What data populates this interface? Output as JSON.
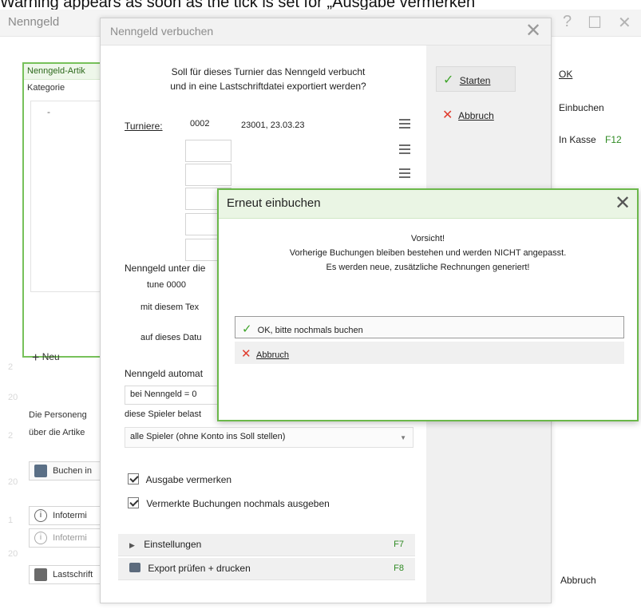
{
  "caption": "Warning appears as soon as the tick is set for „Ausgabe vermerken\"",
  "background": {
    "title": "Nenngeld",
    "panel_header": "Nenngeld-Artik",
    "kategorie_label": "Kategorie",
    "list_item": "-",
    "neu_label": "Neu",
    "personen_line1": "Die Personeng",
    "personen_line2": "über die Artike",
    "buchen_btn": "Buchen in",
    "info_btn1": "Infotermi",
    "info_btn2": "Infotermi",
    "lastschrift_btn": "Lastschrift",
    "right_ok": "OK",
    "right_einbuchen": "Einbuchen",
    "right_kasse": "In Kasse",
    "right_kasse_key": "F12",
    "right_abbruch": "Abbruch"
  },
  "dialog": {
    "title": "Nenngeld verbuchen",
    "question_line1": "Soll für dieses Turnier das Nenngeld verbucht",
    "question_line2": "und in eine Lastschriftdatei exportiert werden?",
    "starten": "Starten",
    "abbruch": "Abbruch",
    "turniere_label": "Turniere:",
    "turnier_nr": "0002",
    "turnier_text": "23001, 23.03.23",
    "nenngeld_unter": "Nenngeld unter die",
    "tune_value": "tune  0000",
    "mit_text": "mit diesem Tex",
    "auf_datum": "auf dieses Datu",
    "automatisch": "Nenngeld automat",
    "bei_nenngeld": "bei Nenngeld = 0",
    "diese_spieler": "diese Spieler belast",
    "spieler_select": "alle Spieler (ohne Konto ins Soll stellen)",
    "check1": "Ausgabe vermerken",
    "check2": "Vermerkte Buchungen nochmals ausgeben",
    "einstellungen": "Einstellungen",
    "einstellungen_key": "F7",
    "export": "Export prüfen + drucken",
    "export_key": "F8"
  },
  "modal": {
    "title": "Erneut einbuchen",
    "line1": "Vorsicht!",
    "line2": "Vorherige Buchungen bleiben bestehen und werden NICHT angepasst.",
    "line3": "Es werden neue, zusätzliche Rechnungen generiert!",
    "ok": "OK, bitte nochmals buchen",
    "abbruch": "Abbruch"
  }
}
